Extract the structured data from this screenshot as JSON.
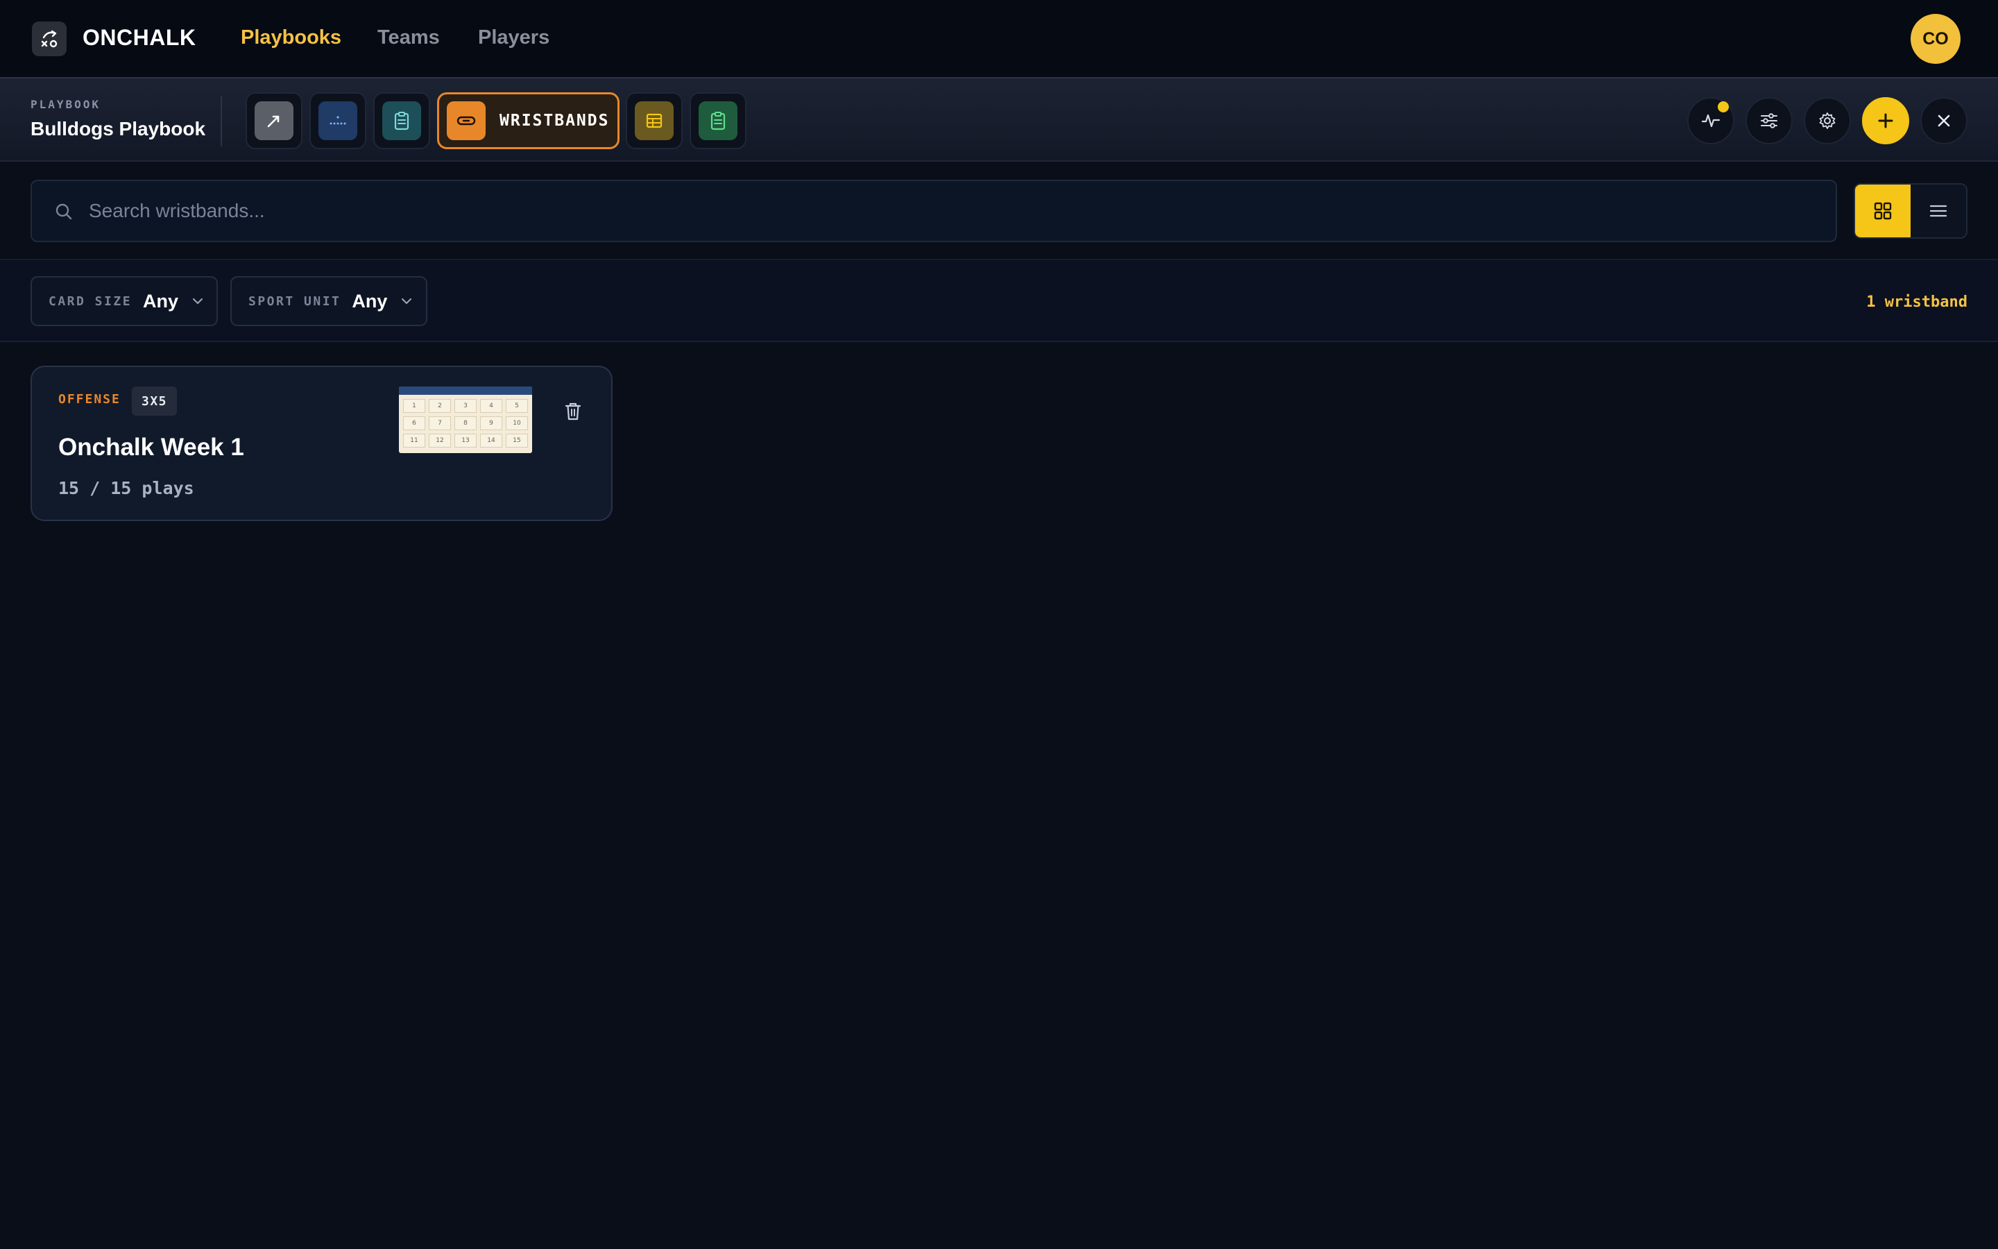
{
  "app": {
    "brand": "ONCHALK",
    "nav": [
      {
        "label": "Playbooks",
        "active": true
      },
      {
        "label": "Teams",
        "active": false
      },
      {
        "label": "Players",
        "active": false
      }
    ],
    "avatar_initials": "CO"
  },
  "toolbar": {
    "section_label": "PLAYBOOK",
    "playbook_title": "Bulldogs Playbook",
    "tools": [
      {
        "name": "draw",
        "icon": "pencil-arrow-icon",
        "color": "#5b5f68"
      },
      {
        "name": "formation",
        "icon": "formation-dots-icon",
        "color": "#1f3b66"
      },
      {
        "name": "playlist",
        "icon": "clipboard-icon",
        "color": "#1d4f58"
      },
      {
        "name": "wristbands",
        "icon": "wristband-icon",
        "color": "#e8872a",
        "label": "WRISTBANDS",
        "active": true
      },
      {
        "name": "table",
        "icon": "table-icon",
        "color": "#6b5a1f"
      },
      {
        "name": "checklist",
        "icon": "clipboard-list-icon",
        "color": "#1f5b3d"
      }
    ],
    "actions": [
      "activity-icon",
      "sliders-icon",
      "gear-icon",
      "plus-icon",
      "close-icon"
    ]
  },
  "search": {
    "placeholder": "Search wristbands...",
    "value": ""
  },
  "view": {
    "mode": "grid"
  },
  "filters": {
    "card_size": {
      "label": "CARD SIZE",
      "value": "Any"
    },
    "sport_unit": {
      "label": "SPORT UNIT",
      "value": "Any"
    },
    "count_text": "1 wristband"
  },
  "wristbands": [
    {
      "unit": "OFFENSE",
      "size": "3X5",
      "title": "Onchalk Week 1",
      "plays": "15 / 15 plays",
      "cells": [
        "1",
        "2",
        "3",
        "4",
        "5",
        "6",
        "7",
        "8",
        "9",
        "10",
        "11",
        "12",
        "13",
        "14",
        "15"
      ]
    }
  ],
  "colors": {
    "accent": "#f5c518",
    "accent_text": "#f5c244",
    "orange": "#e8872a",
    "background": "#0a0e18"
  }
}
